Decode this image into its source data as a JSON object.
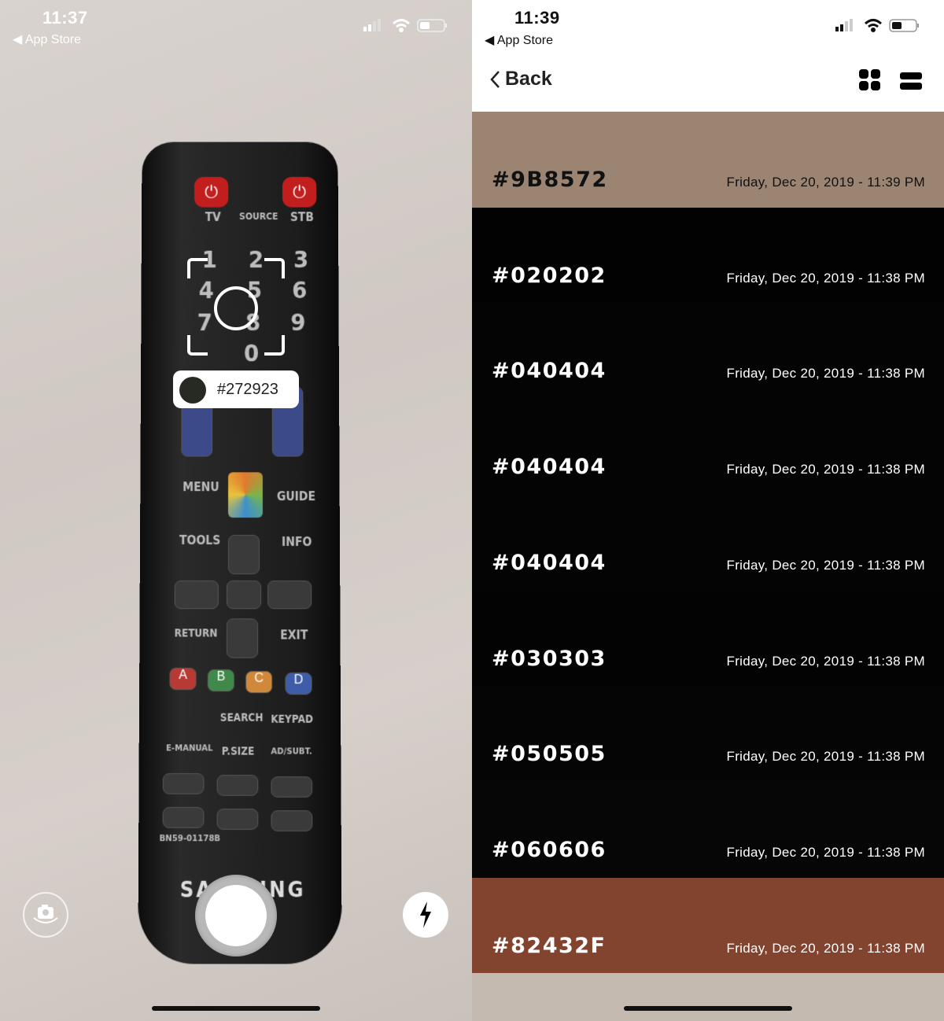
{
  "left": {
    "status": {
      "time": "11:37",
      "back_app": "App Store"
    },
    "picked_color": {
      "hex": "#272923",
      "swatch": "#272923"
    },
    "remote_labels": [
      "TV",
      "SOURCE",
      "STB",
      "1",
      "2",
      "3",
      "4",
      "5",
      "6",
      "7",
      "8",
      "9",
      "0",
      "MENU",
      "GUIDE",
      "TOOLS",
      "INFO",
      "RETURN",
      "EXIT",
      "A",
      "B",
      "C",
      "D",
      "SEARCH",
      "KEYPAD",
      "E-MANUAL",
      "P.SIZE",
      "AD/SUBT.",
      "BN59-01178B",
      "SAMSUNG"
    ],
    "icons": {
      "switch_camera": "camera-rotate-icon",
      "flash": "lightning-icon",
      "shutter": "shutter-button"
    }
  },
  "right": {
    "status": {
      "time": "11:39",
      "back_app": "App Store"
    },
    "nav": {
      "back_label": "Back",
      "grid_view": "grid-icon",
      "list_view": "list-icon"
    },
    "colors": [
      {
        "hex": "#9B8572",
        "date": "Friday, Dec 20, 2019 - 11:39 PM",
        "bg": "#9B8572",
        "fg": "#111111"
      },
      {
        "hex": "#020202",
        "date": "Friday, Dec 20, 2019 - 11:38 PM",
        "bg": "#020202",
        "fg": "#ffffff"
      },
      {
        "hex": "#040404",
        "date": "Friday, Dec 20, 2019 - 11:38 PM",
        "bg": "#040404",
        "fg": "#ffffff"
      },
      {
        "hex": "#040404",
        "date": "Friday, Dec 20, 2019 - 11:38 PM",
        "bg": "#040404",
        "fg": "#ffffff"
      },
      {
        "hex": "#040404",
        "date": "Friday, Dec 20, 2019 - 11:38 PM",
        "bg": "#040404",
        "fg": "#ffffff"
      },
      {
        "hex": "#030303",
        "date": "Friday, Dec 20, 2019 - 11:38 PM",
        "bg": "#030303",
        "fg": "#ffffff"
      },
      {
        "hex": "#050505",
        "date": "Friday, Dec 20, 2019 - 11:38 PM",
        "bg": "#050505",
        "fg": "#ffffff"
      },
      {
        "hex": "#060606",
        "date": "Friday, Dec 20, 2019 - 11:38 PM",
        "bg": "#060606",
        "fg": "#ffffff"
      },
      {
        "hex": "#82432F",
        "date": "Friday, Dec 20, 2019 - 11:38 PM",
        "bg": "#82432F",
        "fg": "#ffffff"
      }
    ],
    "next_row_color": "#C4BAB0"
  }
}
